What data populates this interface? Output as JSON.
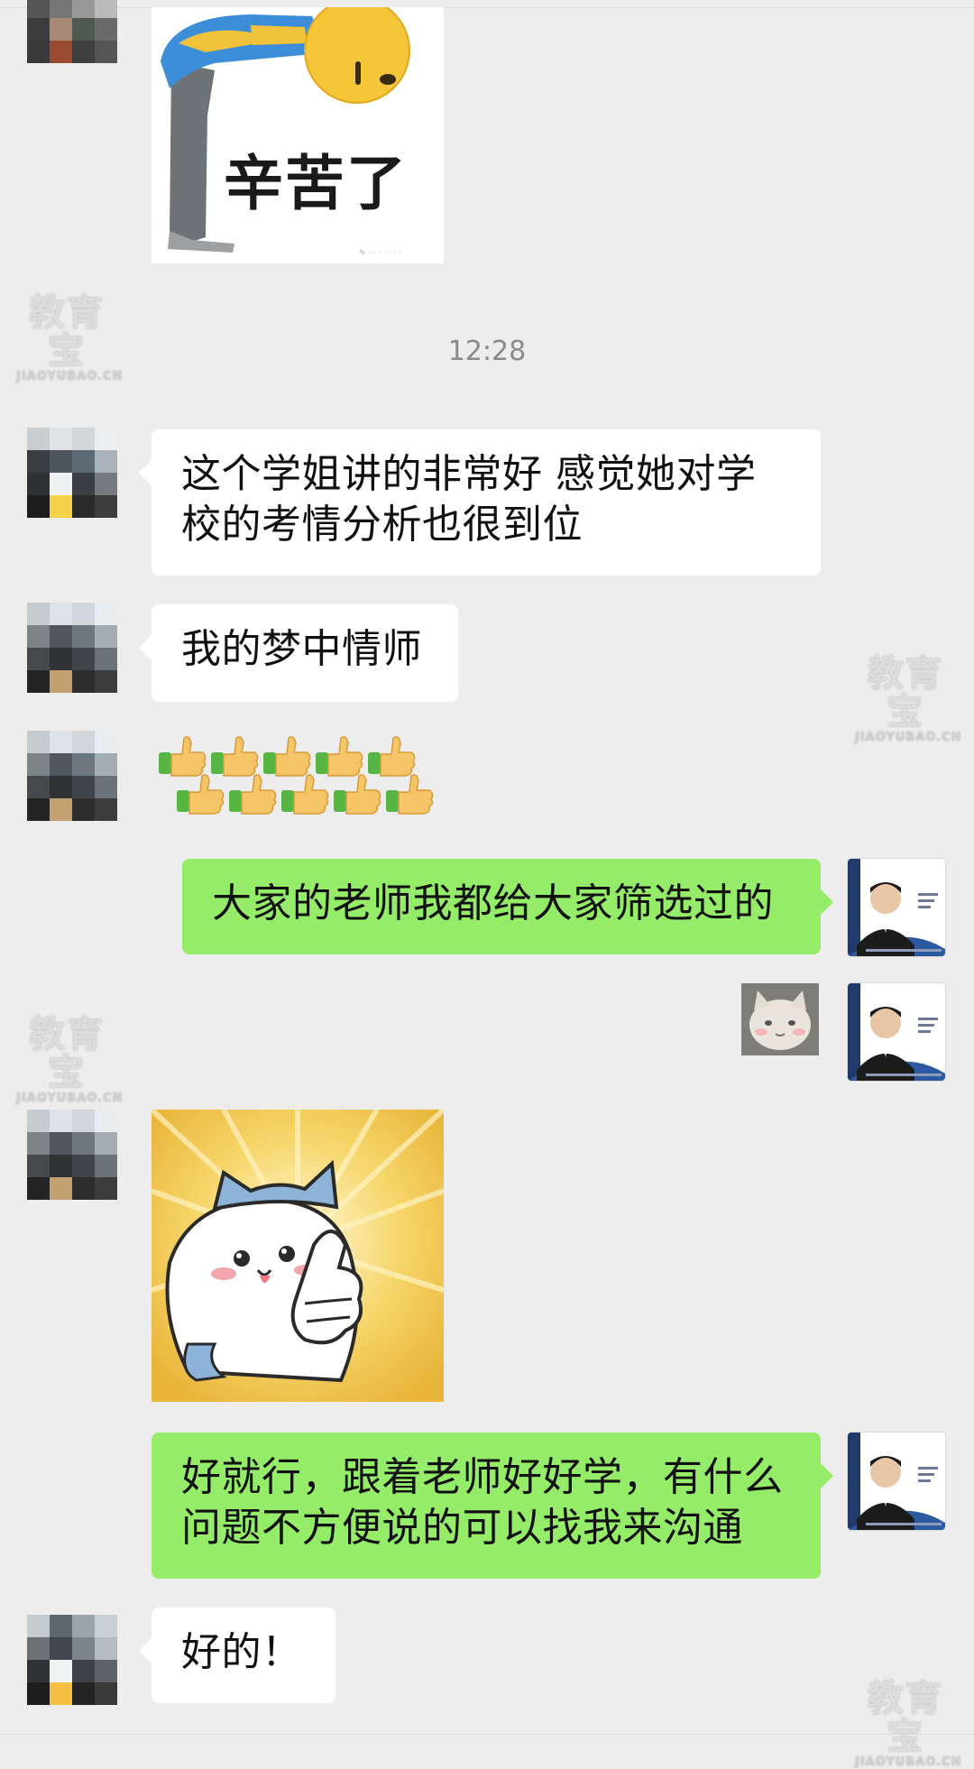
{
  "timestamp": "12:28",
  "sticker_bow": {
    "text": "辛苦了"
  },
  "messages": [
    {
      "text": "这个学姐讲的非常好 感觉她对学校的考情分析也很到位"
    },
    {
      "text": "我的梦中情师"
    },
    {
      "text": "大家的老师我都给大家筛选过的"
    },
    {
      "text": "好就行，跟着老师好好学，有什么问题不方便说的可以找我来沟通"
    },
    {
      "text": "好的！"
    }
  ],
  "emoji_row": {
    "name": "thumbs-up-emoji-cluster",
    "count": 10
  },
  "watermark": {
    "main": "教育宝",
    "sub": "JIAOYUBAO.CN"
  },
  "colors": {
    "incoming": "#ffffff",
    "outgoing": "#95ec69",
    "background": "#ededed"
  }
}
